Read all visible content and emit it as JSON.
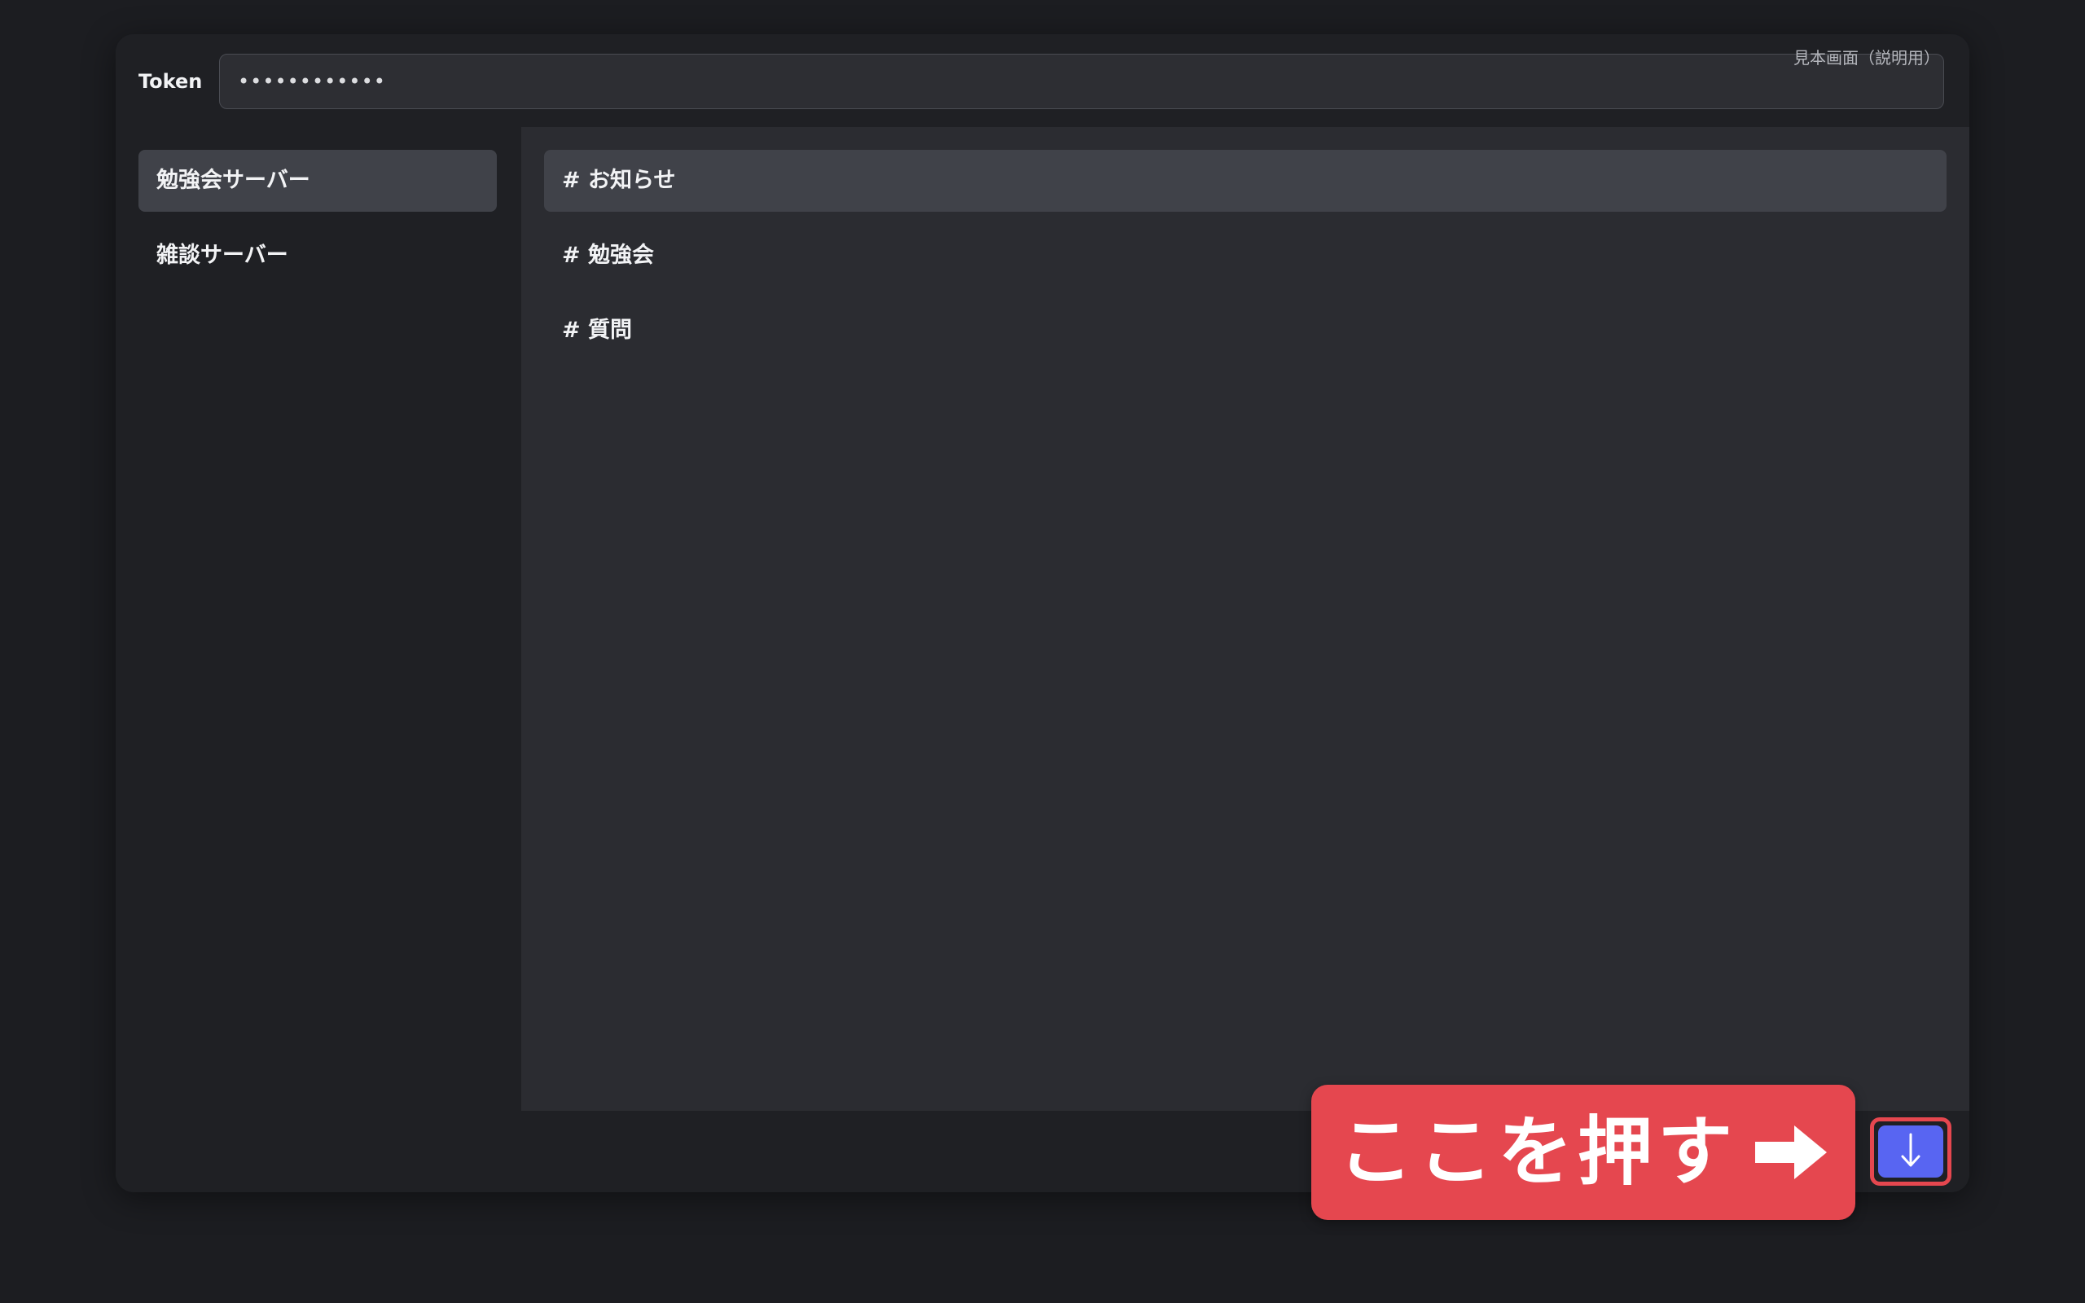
{
  "header": {
    "token_label": "Token",
    "token_value": "••••••••••••",
    "sample_label": "見本画面（説明用）"
  },
  "servers": [
    {
      "label": "勉強会サーバー",
      "active": true
    },
    {
      "label": "雑談サーバー",
      "active": false
    }
  ],
  "channels": [
    {
      "label": "# お知らせ",
      "active": true
    },
    {
      "label": "# 勉強会",
      "active": false
    },
    {
      "label": "# 質問",
      "active": false
    }
  ],
  "callout": {
    "text": "ここを押す",
    "arrow_icon": "right-arrow-icon"
  },
  "download_button": {
    "icon": "down-arrow-icon",
    "accent": "#5865f2",
    "highlight": "#e5474f"
  }
}
